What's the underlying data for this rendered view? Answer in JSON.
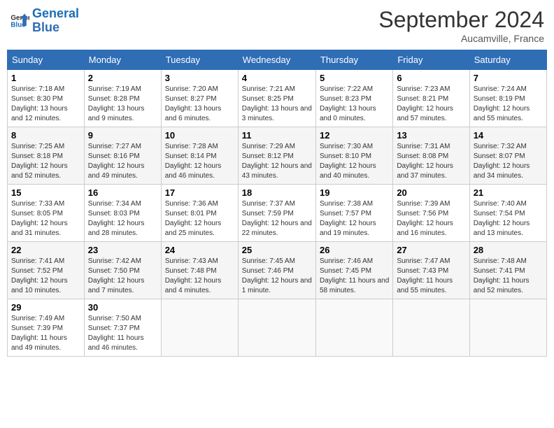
{
  "header": {
    "logo_line1": "General",
    "logo_line2": "Blue",
    "month": "September 2024",
    "location": "Aucamville, France"
  },
  "days_of_week": [
    "Sunday",
    "Monday",
    "Tuesday",
    "Wednesday",
    "Thursday",
    "Friday",
    "Saturday"
  ],
  "weeks": [
    [
      {
        "day": "1",
        "sunrise": "7:18 AM",
        "sunset": "8:30 PM",
        "daylight": "13 hours and 12 minutes."
      },
      {
        "day": "2",
        "sunrise": "7:19 AM",
        "sunset": "8:28 PM",
        "daylight": "13 hours and 9 minutes."
      },
      {
        "day": "3",
        "sunrise": "7:20 AM",
        "sunset": "8:27 PM",
        "daylight": "13 hours and 6 minutes."
      },
      {
        "day": "4",
        "sunrise": "7:21 AM",
        "sunset": "8:25 PM",
        "daylight": "13 hours and 3 minutes."
      },
      {
        "day": "5",
        "sunrise": "7:22 AM",
        "sunset": "8:23 PM",
        "daylight": "13 hours and 0 minutes."
      },
      {
        "day": "6",
        "sunrise": "7:23 AM",
        "sunset": "8:21 PM",
        "daylight": "12 hours and 57 minutes."
      },
      {
        "day": "7",
        "sunrise": "7:24 AM",
        "sunset": "8:19 PM",
        "daylight": "12 hours and 55 minutes."
      }
    ],
    [
      {
        "day": "8",
        "sunrise": "7:25 AM",
        "sunset": "8:18 PM",
        "daylight": "12 hours and 52 minutes."
      },
      {
        "day": "9",
        "sunrise": "7:27 AM",
        "sunset": "8:16 PM",
        "daylight": "12 hours and 49 minutes."
      },
      {
        "day": "10",
        "sunrise": "7:28 AM",
        "sunset": "8:14 PM",
        "daylight": "12 hours and 46 minutes."
      },
      {
        "day": "11",
        "sunrise": "7:29 AM",
        "sunset": "8:12 PM",
        "daylight": "12 hours and 43 minutes."
      },
      {
        "day": "12",
        "sunrise": "7:30 AM",
        "sunset": "8:10 PM",
        "daylight": "12 hours and 40 minutes."
      },
      {
        "day": "13",
        "sunrise": "7:31 AM",
        "sunset": "8:08 PM",
        "daylight": "12 hours and 37 minutes."
      },
      {
        "day": "14",
        "sunrise": "7:32 AM",
        "sunset": "8:07 PM",
        "daylight": "12 hours and 34 minutes."
      }
    ],
    [
      {
        "day": "15",
        "sunrise": "7:33 AM",
        "sunset": "8:05 PM",
        "daylight": "12 hours and 31 minutes."
      },
      {
        "day": "16",
        "sunrise": "7:34 AM",
        "sunset": "8:03 PM",
        "daylight": "12 hours and 28 minutes."
      },
      {
        "day": "17",
        "sunrise": "7:36 AM",
        "sunset": "8:01 PM",
        "daylight": "12 hours and 25 minutes."
      },
      {
        "day": "18",
        "sunrise": "7:37 AM",
        "sunset": "7:59 PM",
        "daylight": "12 hours and 22 minutes."
      },
      {
        "day": "19",
        "sunrise": "7:38 AM",
        "sunset": "7:57 PM",
        "daylight": "12 hours and 19 minutes."
      },
      {
        "day": "20",
        "sunrise": "7:39 AM",
        "sunset": "7:56 PM",
        "daylight": "12 hours and 16 minutes."
      },
      {
        "day": "21",
        "sunrise": "7:40 AM",
        "sunset": "7:54 PM",
        "daylight": "12 hours and 13 minutes."
      }
    ],
    [
      {
        "day": "22",
        "sunrise": "7:41 AM",
        "sunset": "7:52 PM",
        "daylight": "12 hours and 10 minutes."
      },
      {
        "day": "23",
        "sunrise": "7:42 AM",
        "sunset": "7:50 PM",
        "daylight": "12 hours and 7 minutes."
      },
      {
        "day": "24",
        "sunrise": "7:43 AM",
        "sunset": "7:48 PM",
        "daylight": "12 hours and 4 minutes."
      },
      {
        "day": "25",
        "sunrise": "7:45 AM",
        "sunset": "7:46 PM",
        "daylight": "12 hours and 1 minute."
      },
      {
        "day": "26",
        "sunrise": "7:46 AM",
        "sunset": "7:45 PM",
        "daylight": "11 hours and 58 minutes."
      },
      {
        "day": "27",
        "sunrise": "7:47 AM",
        "sunset": "7:43 PM",
        "daylight": "11 hours and 55 minutes."
      },
      {
        "day": "28",
        "sunrise": "7:48 AM",
        "sunset": "7:41 PM",
        "daylight": "11 hours and 52 minutes."
      }
    ],
    [
      {
        "day": "29",
        "sunrise": "7:49 AM",
        "sunset": "7:39 PM",
        "daylight": "11 hours and 49 minutes."
      },
      {
        "day": "30",
        "sunrise": "7:50 AM",
        "sunset": "7:37 PM",
        "daylight": "11 hours and 46 minutes."
      },
      null,
      null,
      null,
      null,
      null
    ]
  ]
}
